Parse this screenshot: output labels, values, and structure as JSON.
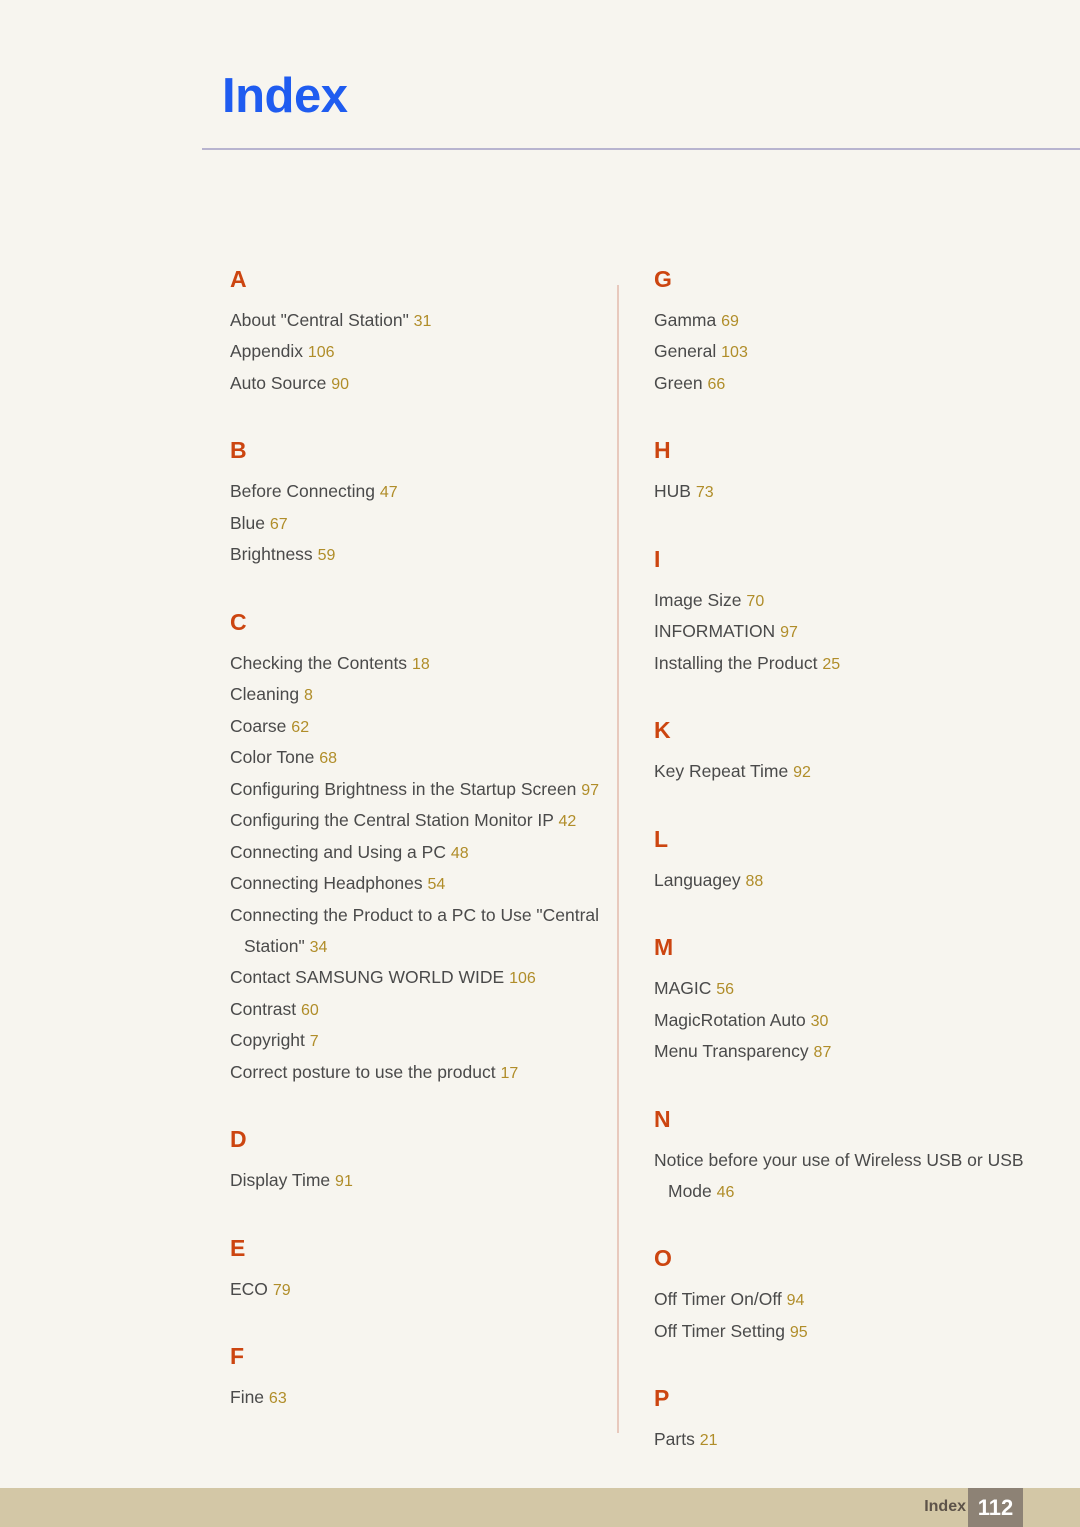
{
  "header": {
    "title": "Index"
  },
  "footer": {
    "label": "Index",
    "page_number": "112"
  },
  "colors": {
    "page_background": "#f7f5ef",
    "title_blue": "#1f5cf0",
    "section_letter_orange": "#cc4510",
    "entry_text_gray": "#4a4a4a",
    "page_number_gold": "#b08d29",
    "header_rule": "#b8b4cf",
    "column_divider": "#e8c9bd",
    "footer_band": "#d3c7a6",
    "footer_page_box": "#8d8275"
  },
  "index": {
    "columns": [
      {
        "sections": [
          {
            "letter": "A",
            "entries": [
              {
                "text": "About \"Central Station\"",
                "page": "31"
              },
              {
                "text": "Appendix",
                "page": "106"
              },
              {
                "text": "Auto Source",
                "page": "90"
              }
            ]
          },
          {
            "letter": "B",
            "entries": [
              {
                "text": "Before Connecting",
                "page": "47"
              },
              {
                "text": "Blue",
                "page": "67"
              },
              {
                "text": "Brightness",
                "page": "59"
              }
            ]
          },
          {
            "letter": "C",
            "entries": [
              {
                "text": "Checking the Contents",
                "page": "18"
              },
              {
                "text": "Cleaning",
                "page": "8"
              },
              {
                "text": "Coarse",
                "page": "62"
              },
              {
                "text": "Color Tone",
                "page": "68"
              },
              {
                "text": "Configuring Brightness in the Startup Screen",
                "page": "97"
              },
              {
                "text": "Configuring the Central Station Monitor IP",
                "page": "42"
              },
              {
                "text": "Connecting and Using a PC",
                "page": "48"
              },
              {
                "text": "Connecting Headphones",
                "page": "54"
              },
              {
                "text": "Connecting the Product to a PC to Use \"Central Station\"",
                "page": "34"
              },
              {
                "text": "Contact SAMSUNG WORLD WIDE",
                "page": "106"
              },
              {
                "text": "Contrast",
                "page": "60"
              },
              {
                "text": "Copyright",
                "page": "7"
              },
              {
                "text": "Correct posture to use the product",
                "page": "17"
              }
            ]
          },
          {
            "letter": "D",
            "entries": [
              {
                "text": "Display Time",
                "page": "91"
              }
            ]
          },
          {
            "letter": "E",
            "entries": [
              {
                "text": "ECO",
                "page": "79"
              }
            ]
          },
          {
            "letter": "F",
            "entries": [
              {
                "text": "Fine",
                "page": "63"
              }
            ]
          }
        ]
      },
      {
        "sections": [
          {
            "letter": "G",
            "entries": [
              {
                "text": "Gamma",
                "page": "69"
              },
              {
                "text": "General",
                "page": "103"
              },
              {
                "text": "Green",
                "page": "66"
              }
            ]
          },
          {
            "letter": "H",
            "entries": [
              {
                "text": "HUB",
                "page": "73"
              }
            ]
          },
          {
            "letter": "I",
            "entries": [
              {
                "text": "Image Size",
                "page": "70"
              },
              {
                "text": "INFORMATION",
                "page": "97"
              },
              {
                "text": "Installing the Product",
                "page": "25"
              }
            ]
          },
          {
            "letter": "K",
            "entries": [
              {
                "text": "Key Repeat Time",
                "page": "92"
              }
            ]
          },
          {
            "letter": "L",
            "entries": [
              {
                "text": "Languagey",
                "page": "88"
              }
            ]
          },
          {
            "letter": "M",
            "entries": [
              {
                "text": "MAGIC",
                "page": "56"
              },
              {
                "text": "MagicRotation Auto",
                "page": "30"
              },
              {
                "text": "Menu Transparency",
                "page": "87"
              }
            ]
          },
          {
            "letter": "N",
            "entries": [
              {
                "text": "Notice before your use of Wireless USB or USB Mode",
                "page": "46"
              }
            ]
          },
          {
            "letter": "O",
            "entries": [
              {
                "text": "Off Timer On/Off",
                "page": "94"
              },
              {
                "text": "Off Timer Setting",
                "page": "95"
              }
            ]
          },
          {
            "letter": "P",
            "entries": [
              {
                "text": "Parts",
                "page": "21"
              }
            ]
          }
        ]
      }
    ]
  }
}
